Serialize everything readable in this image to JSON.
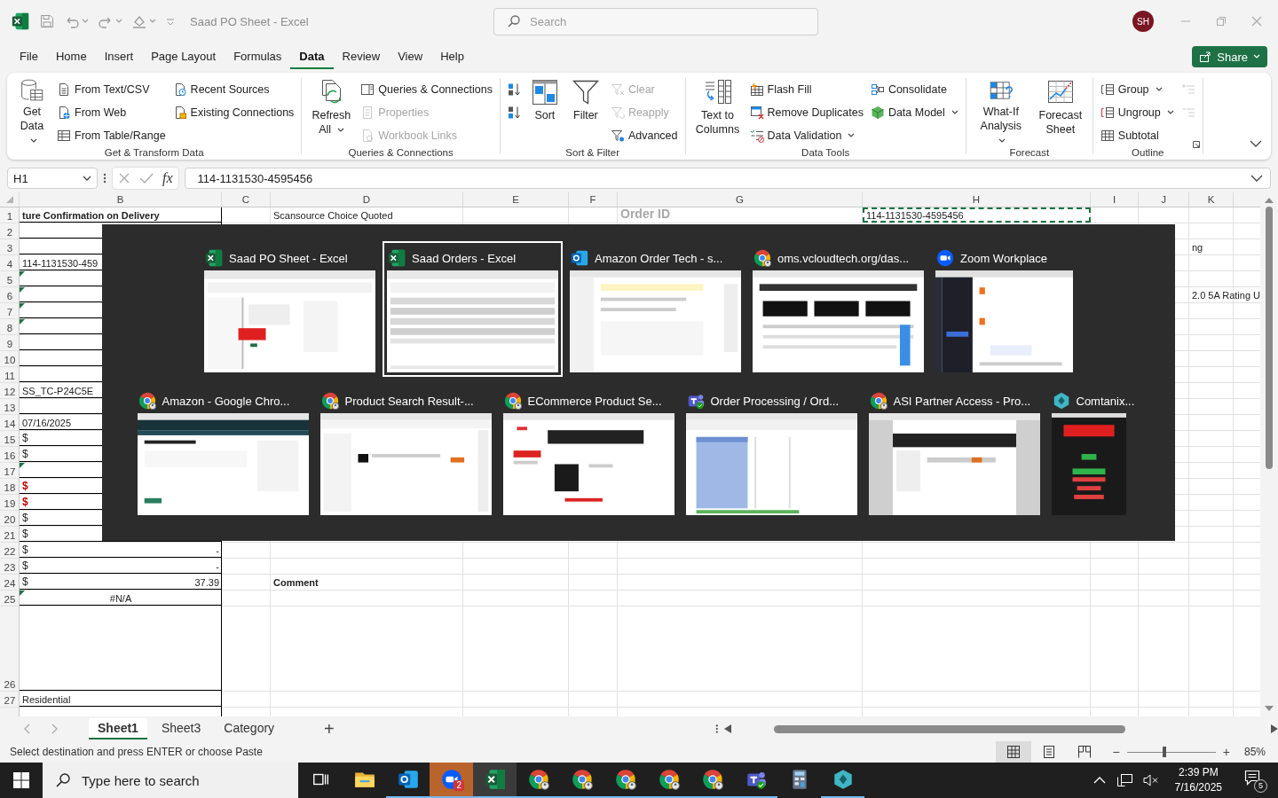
{
  "title_bar": {
    "title": "Saad PO Sheet - Excel",
    "search": {
      "placeholder": "Search"
    },
    "avatar": "SH"
  },
  "menu_tabs": [
    {
      "label": "File",
      "selected": false
    },
    {
      "label": "Home",
      "selected": false
    },
    {
      "label": "Insert",
      "selected": false
    },
    {
      "label": "Page Layout",
      "selected": false
    },
    {
      "label": "Formulas",
      "selected": false
    },
    {
      "label": "Data",
      "selected": true
    },
    {
      "label": "Review",
      "selected": false
    },
    {
      "label": "View",
      "selected": false
    },
    {
      "label": "Help",
      "selected": false
    }
  ],
  "share_button": "Share",
  "ribbon": {
    "groups": [
      {
        "label": "Get & Transform Data",
        "items": [
          {
            "kind": "large",
            "label": "Get Data",
            "dropdown": true,
            "disabled": false
          },
          {
            "kind": "small",
            "label": "From Text/CSV",
            "dropdown": false,
            "disabled": false
          },
          {
            "kind": "small",
            "label": "From Web",
            "dropdown": false,
            "disabled": false
          },
          {
            "kind": "small",
            "label": "From Table/Range",
            "dropdown": false,
            "disabled": false
          },
          {
            "kind": "small",
            "label": "Recent Sources",
            "dropdown": false,
            "disabled": false
          },
          {
            "kind": "small",
            "label": "Existing Connections",
            "dropdown": false,
            "disabled": false
          }
        ]
      },
      {
        "label": "Queries & Connections",
        "items": [
          {
            "kind": "large",
            "label": "Refresh All",
            "dropdown": true,
            "disabled": false
          },
          {
            "kind": "small",
            "label": "Queries & Connections",
            "dropdown": false,
            "disabled": false
          },
          {
            "kind": "small",
            "label": "Properties",
            "dropdown": false,
            "disabled": true
          },
          {
            "kind": "small",
            "label": "Workbook Links",
            "dropdown": false,
            "disabled": true
          }
        ]
      },
      {
        "label": "Sort & Filter",
        "items": [
          {
            "kind": "icon",
            "dropdown": false,
            "disabled": false
          },
          {
            "kind": "icon",
            "dropdown": false,
            "disabled": false
          },
          {
            "kind": "large",
            "label": "Sort",
            "dropdown": false,
            "disabled": false
          },
          {
            "kind": "large",
            "label": "Filter",
            "dropdown": false,
            "disabled": false
          },
          {
            "kind": "small",
            "label": "Clear",
            "dropdown": false,
            "disabled": true
          },
          {
            "kind": "small",
            "label": "Reapply",
            "dropdown": false,
            "disabled": true
          },
          {
            "kind": "small",
            "label": "Advanced",
            "dropdown": false,
            "disabled": false
          }
        ]
      },
      {
        "label": "Data Tools",
        "items": [
          {
            "kind": "large",
            "label": "Text to Columns",
            "dropdown": false,
            "disabled": false
          },
          {
            "kind": "small",
            "label": "Flash Fill",
            "dropdown": false,
            "disabled": false
          },
          {
            "kind": "small",
            "label": "Remove Duplicates",
            "dropdown": false,
            "disabled": false
          },
          {
            "kind": "small",
            "label": "Data Validation",
            "dropdown": true,
            "disabled": false
          },
          {
            "kind": "small",
            "label": "Consolidate",
            "dropdown": false,
            "disabled": false
          },
          {
            "kind": "small",
            "label": "Data Model",
            "dropdown": true,
            "disabled": false
          }
        ]
      },
      {
        "label": "Forecast",
        "items": [
          {
            "kind": "large",
            "label": "What-If Analysis",
            "dropdown": true,
            "disabled": false
          },
          {
            "kind": "large",
            "label": "Forecast Sheet",
            "dropdown": false,
            "disabled": false
          }
        ]
      },
      {
        "label": "Outline",
        "launcher": true,
        "items": [
          {
            "kind": "small",
            "label": "Group",
            "dropdown": true,
            "disabled": false
          },
          {
            "kind": "small",
            "label": "Ungroup",
            "dropdown": true,
            "disabled": false
          },
          {
            "kind": "small",
            "label": "Subtotal",
            "dropdown": false,
            "disabled": false
          },
          {
            "kind": "icon",
            "dropdown": false,
            "disabled": true
          },
          {
            "kind": "icon",
            "dropdown": false,
            "disabled": true
          }
        ]
      }
    ]
  },
  "formula_bar": {
    "name_box": "H1",
    "function_label": "fx",
    "value": "114-1131530-4595456"
  },
  "sheet": {
    "columns": [
      "B",
      "C",
      "D",
      "E",
      "F",
      "G",
      "H",
      "I",
      "J",
      "K"
    ],
    "rows": [
      {
        "number": "1",
        "cells": {
          "B": {
            "text": "ture Confirmation on Delivery",
            "bold": true
          },
          "D": {
            "text": "Scansource Choice Quoted"
          },
          "G": {
            "text": "Order ID",
            "kind": "heading"
          },
          "H": {
            "text": "114-1131530-4595456",
            "marquee": true
          }
        }
      },
      {
        "number": "2"
      },
      {
        "number": "3",
        "cells": {
          "K": {
            "text": "ng"
          }
        }
      },
      {
        "number": "4",
        "cells": {
          "B": {
            "text": "114-1131530-459"
          }
        }
      },
      {
        "number": "5",
        "cells": {
          "B": {
            "error_flag": true
          }
        }
      },
      {
        "number": "6",
        "cells": {
          "B": {
            "error_flag": true
          },
          "K": {
            "text": "2.0 5A Rating U"
          }
        }
      },
      {
        "number": "7",
        "cells": {
          "B": {
            "error_flag": true
          }
        }
      },
      {
        "number": "8",
        "cells": {
          "B": {
            "error_flag": true
          }
        }
      },
      {
        "number": "9"
      },
      {
        "number": "10"
      },
      {
        "number": "11"
      },
      {
        "number": "12",
        "cells": {
          "B": {
            "text": "SS_TC-P24C5E"
          }
        }
      },
      {
        "number": "13"
      },
      {
        "number": "14",
        "cells": {
          "B": {
            "text": "07/16/2025"
          }
        }
      },
      {
        "number": "15",
        "cells": {
          "B": {
            "symbol": "$"
          }
        }
      },
      {
        "number": "16",
        "cells": {
          "B": {
            "symbol": "$"
          }
        }
      },
      {
        "number": "17",
        "cells": {
          "B": {
            "error_flag": true
          }
        }
      },
      {
        "number": "18",
        "cells": {
          "B": {
            "symbol": "$",
            "color": "#c00000"
          }
        }
      },
      {
        "number": "19",
        "cells": {
          "B": {
            "symbol": "$",
            "color": "#c00000"
          }
        }
      },
      {
        "number": "20",
        "cells": {
          "B": {
            "symbol": "$"
          }
        }
      },
      {
        "number": "21",
        "cells": {
          "B": {
            "symbol": "$"
          }
        }
      },
      {
        "number": "22",
        "cells": {
          "B": {
            "symbol": "$",
            "text": "-"
          }
        }
      },
      {
        "number": "23",
        "cells": {
          "B": {
            "symbol": "$",
            "text": "-"
          }
        }
      },
      {
        "number": "24",
        "cells": {
          "B": {
            "symbol": "$",
            "text": "37.39"
          },
          "D": {
            "text": "Comment",
            "bold": true
          }
        }
      },
      {
        "number": "25",
        "cells": {
          "B": {
            "text": "#N/A",
            "kind": "error",
            "error_flag": true
          }
        }
      },
      {
        "number": "26"
      },
      {
        "number": "27",
        "cells": {
          "B": {
            "text": "Residential"
          }
        }
      }
    ]
  },
  "sheet_tabs": {
    "tabs": [
      {
        "label": "Sheet1",
        "selected": true
      },
      {
        "label": "Sheet3",
        "selected": false
      },
      {
        "label": "Category",
        "selected": false
      }
    ],
    "add": "+"
  },
  "status_bar": {
    "message": "Select destination and press ENTER or choose Paste",
    "views": [
      {
        "selected": true
      },
      {
        "selected": false
      },
      {
        "selected": false
      }
    ],
    "zoom": {
      "minus": "−",
      "plus": "+",
      "level": 0.42,
      "reading": "85%"
    }
  },
  "task_switcher": {
    "windows": [
      {
        "kind": "excel",
        "title": "Saad PO Sheet - Excel",
        "selected": false
      },
      {
        "kind": "excel",
        "title": "Saad Orders - Excel",
        "selected": true
      },
      {
        "kind": "outlook",
        "title": "Amazon Order Tech - s...",
        "selected": false
      },
      {
        "kind": "chrome",
        "title": "oms.vcloudtech.org/das...",
        "selected": false
      },
      {
        "kind": "zoom",
        "title": "Zoom Workplace",
        "selected": false
      },
      {
        "kind": "chrome",
        "title": "Amazon - Google Chro...",
        "selected": false
      },
      {
        "kind": "chrome",
        "title": "Product Search Result-...",
        "selected": false
      },
      {
        "kind": "chrome",
        "title": "ECommerce Product Se...",
        "selected": false
      },
      {
        "kind": "teams",
        "title": "Order Processing / Ord...",
        "selected": false
      },
      {
        "kind": "chrome",
        "title": "ASI Partner Access - Pro...",
        "selected": false
      },
      {
        "kind": "comtanix",
        "title": "Comtanix...",
        "selected": false
      }
    ]
  },
  "taskbar": {
    "search": {
      "placeholder": "Type here to search"
    },
    "apps": [
      {
        "kind": "taskview",
        "running": false,
        "active": false,
        "attention": false
      },
      {
        "kind": "files",
        "running": false,
        "active": false,
        "attention": false
      },
      {
        "kind": "outlook",
        "running": true,
        "active": false,
        "attention": false
      },
      {
        "kind": "zoom",
        "running": true,
        "active": false,
        "attention": true,
        "badge": "2"
      },
      {
        "kind": "excel",
        "running": true,
        "active": true,
        "attention": false
      },
      {
        "kind": "chrome",
        "running": true,
        "active": false,
        "attention": false
      },
      {
        "kind": "chrome",
        "running": true,
        "active": false,
        "attention": false
      },
      {
        "kind": "chrome",
        "running": true,
        "active": false,
        "attention": false
      },
      {
        "kind": "chrome",
        "running": true,
        "active": false,
        "attention": false
      },
      {
        "kind": "chrome",
        "running": true,
        "active": false,
        "attention": false
      },
      {
        "kind": "teams",
        "running": true,
        "active": false,
        "attention": false
      },
      {
        "kind": "calculator",
        "running": false,
        "active": false,
        "attention": false
      },
      {
        "kind": "comtanix",
        "running": true,
        "active": false,
        "attention": false
      }
    ],
    "clock": {
      "time": "2:39 PM",
      "date": "7/16/2025"
    },
    "notifications": "5"
  }
}
